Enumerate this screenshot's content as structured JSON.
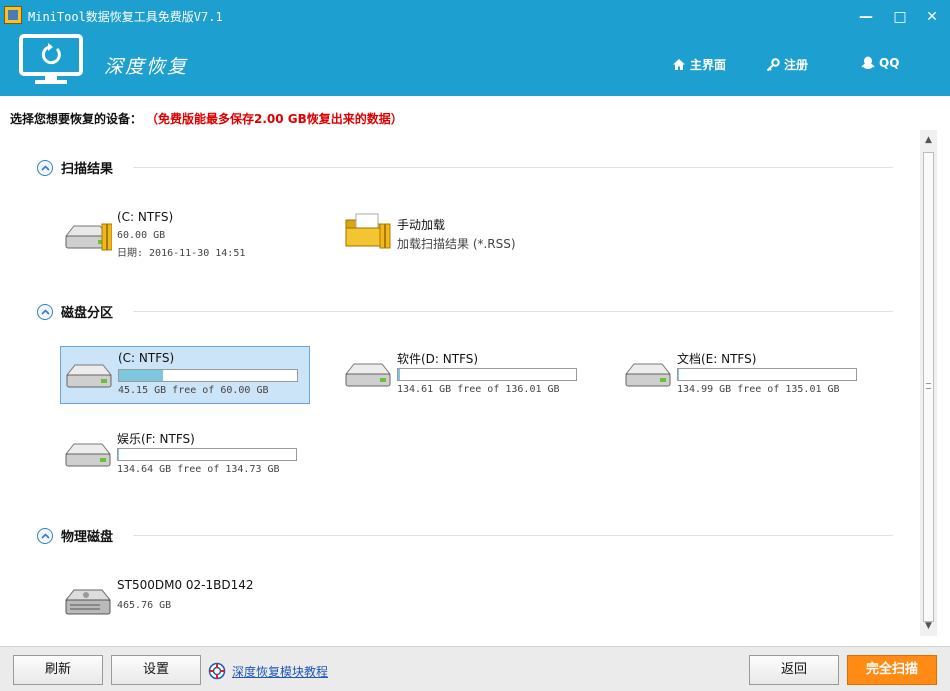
{
  "window": {
    "title": "MiniTool数据恢复工具免费版V7.1",
    "min_glyph": "—",
    "max_glyph": "□",
    "close_glyph": "✕"
  },
  "header": {
    "product_name": "深度恢复",
    "nav": {
      "home": "主界面",
      "register": "注册",
      "qq": "QQ"
    },
    "accent_color": "#1d9fcf"
  },
  "prompt": {
    "label": "选择您想要恢复的设备：",
    "warning": "（免费版能最多保存2.00 GB恢复出来的数据）",
    "warning_color": "#e00000"
  },
  "sections": {
    "scan_results": {
      "title": "扫描结果",
      "items": [
        {
          "name": "(C: NTFS)",
          "size": "60.00 GB",
          "date": "日期: 2016-11-30 14:51",
          "icon": "hard-drive-icon"
        },
        {
          "name": "手动加载",
          "description": "加载扫描结果 (*.RSS)",
          "icon": "folder-icon"
        }
      ]
    },
    "partitions": {
      "title": "磁盘分区",
      "items": [
        {
          "name": "(C: NTFS)",
          "free": "45.15 GB free of 60.00 GB",
          "used_fraction": 0.248,
          "selected": true
        },
        {
          "name": "软件(D: NTFS)",
          "free": "134.61 GB free of 136.01 GB",
          "used_fraction": 0.01,
          "selected": false
        },
        {
          "name": "文档(E: NTFS)",
          "free": "134.99 GB free of 135.01 GB",
          "used_fraction": 0.001,
          "selected": false
        },
        {
          "name": "娱乐(F: NTFS)",
          "free": "134.64 GB free of 134.73 GB",
          "used_fraction": 0.001,
          "selected": false
        }
      ]
    },
    "physical_disks": {
      "title": "物理磁盘",
      "items": [
        {
          "name": "ST500DM0 02-1BD142",
          "size": "465.76 GB",
          "icon": "physical-disk-icon"
        }
      ]
    }
  },
  "footer": {
    "refresh": "刷新",
    "settings": "设置",
    "tutorial": "深度恢复模块教程",
    "back": "返回",
    "full_scan": "完全扫描",
    "full_scan_color": "#ff8b14"
  }
}
